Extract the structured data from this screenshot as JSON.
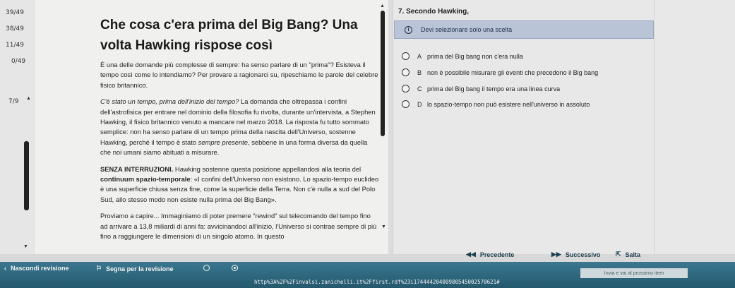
{
  "progress": {
    "items": [
      "39/49",
      "38/49",
      "11/49",
      "0/49",
      "7/9"
    ]
  },
  "article": {
    "title": "Che cosa c'era prima del Big Bang? Una volta Hawking rispose così",
    "p1": "È una delle domande più complesse di sempre: ha senso parlare di un \"prima\"? Esisteva il tempo così come lo intendiamo? Per provare a ragionarci su, ripeschiamo le parole del celebre fisico britannico.",
    "p2_italic": "C'è stato un tempo, prima dell'inizio del tempo?",
    "p2_rest_a": " La domanda che oltrepassa i confini dell'astrofisica per entrare nel dominio della filosofia fu rivolta, durante un'intervista, a Stephen Hawking, il fisico britannico venuto a mancare nel marzo 2018. La risposta fu tutto sommato semplice: non ha senso parlare di un tempo prima della nascita dell'Universo, sostenne Hawking, perché il tempo è stato ",
    "p2_italic2": "sempre presente",
    "p2_rest_b": ", sebbene in una forma diversa da quella che noi umani siamo abituati a misurare.",
    "p3_bold": "SENZA INTERRUZIONI.",
    "p3_rest_a": " Hawking sostenne questa posizione appellandosi alla teoria del ",
    "p3_bold2": "continuum spazio-temporale",
    "p3_rest_b": ": «I confini dell'Universo non esistono. Lo spazio-tempo euclideo è una superficie chiusa senza fine, come la superficie della Terra. Non c'è nulla a sud del Polo Sud, allo stesso modo non esiste nulla prima del Big Bang».",
    "p4": "Proviamo a capire... Immaginiamo di poter premere \"rewind\" sul telecomando del tempo fino ad arrivare a 13,8 miliardi di anni fa: avvicinandoci all'inizio, l'Universo si contrae sempre di più fino a raggiungere le dimensioni di un singolo atomo. In questo"
  },
  "question": {
    "title": "7. Secondo Hawking,",
    "notice": "Devi selezionare solo una scelta",
    "options": [
      {
        "letter": "A",
        "text": "prima del Big bang non c'era nulla"
      },
      {
        "letter": "B",
        "text": "non è possibile misurare gli eventi che precedono il Big bang"
      },
      {
        "letter": "C",
        "text": "prima del Big bang il tempo era una linea curva"
      },
      {
        "letter": "D",
        "text": "lo spazio-tempo non può esistere nell'universo in assoluto"
      }
    ]
  },
  "toolbar": {
    "hide_review": "Nascondi revisione",
    "mark_review": "Segna per la revisione",
    "previous": "Precedente",
    "next": "Successivo",
    "exit": "Salta",
    "hint": "Invia e vai al prossimo item",
    "url": "http%3A%2F%2Finvalsi.zanichelli.it%2Ffirst.rdf%23i1744442040098054500257062​1#"
  }
}
